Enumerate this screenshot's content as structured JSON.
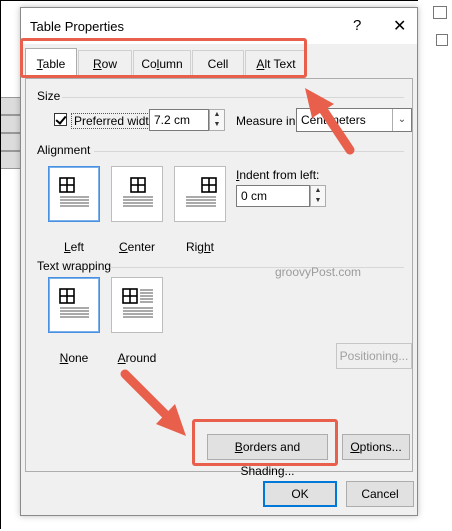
{
  "dialog": {
    "title": "Table Properties",
    "help_glyph": "?",
    "close_glyph": "✕"
  },
  "tabs": [
    {
      "label": "Table",
      "mnemonic": "T",
      "rest": "able"
    },
    {
      "label": "Row",
      "mnemonic": "R",
      "rest": "ow"
    },
    {
      "label": "Column",
      "mnemonic": "l",
      "pre": "Co",
      "rest": "umn"
    },
    {
      "label": "Cell",
      "mnemonic": "E",
      "pre": "C",
      "rest": "ll",
      "display": "Cell"
    },
    {
      "label": "Alt Text",
      "mnemonic": "A",
      "rest": "lt Text"
    }
  ],
  "size": {
    "group_label": "Size",
    "preferred_width_label": "Preferred width:",
    "preferred_width_checked": true,
    "preferred_width_value": "7.2 cm",
    "measure_in_label": "Measure in:",
    "measure_in_value": "Centimeters"
  },
  "alignment": {
    "group_label": "Alignment",
    "options": [
      "Left",
      "Center",
      "Right"
    ],
    "selected": "Left",
    "indent_label": "Indent from left:",
    "indent_value": "0 cm"
  },
  "text_wrapping": {
    "group_label": "Text wrapping",
    "options": [
      "None",
      "Around"
    ],
    "selected": "None"
  },
  "buttons": {
    "positioning": "Positioning...",
    "borders_shading": "Borders and Shading...",
    "options": "Options...",
    "ok": "OK",
    "cancel": "Cancel"
  },
  "watermark": "groovyPost.com",
  "colors": {
    "highlight_box": "#e8604c",
    "selection": "#4a90e2",
    "primary_border": "#0078d7"
  }
}
